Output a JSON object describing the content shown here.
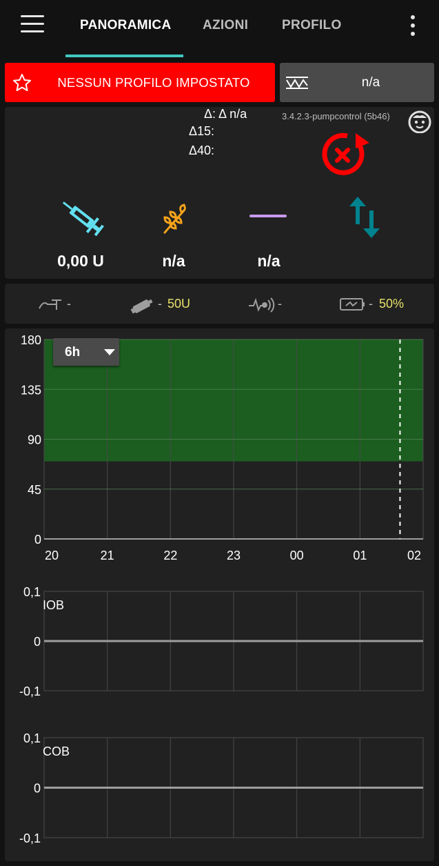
{
  "tabs": [
    {
      "label": "PANORAMICA",
      "active": true
    },
    {
      "label": "AZIONI",
      "active": false
    },
    {
      "label": "PROFILO",
      "active": false
    }
  ],
  "profile": {
    "label": "NESSUN PROFILO IMPOSTATO",
    "color": "#fe0000"
  },
  "target": {
    "value": "n/a"
  },
  "info": {
    "delta": "Δ: Δ n/a",
    "delta15": "Δ15:",
    "delta40": "Δ40:",
    "version": "3.4.2.3-pumpcontrol (5b46)",
    "iob_value": "0,00 U",
    "cob_value": "n/a",
    "basal_value": "n/a"
  },
  "status": {
    "cannula": "-",
    "reservoir_sep": "-",
    "reservoir": "50U",
    "sensor": "-",
    "battery_sep": "-",
    "battery": "50%"
  },
  "range_select": {
    "value": "6h"
  },
  "chart_data": [
    {
      "type": "line",
      "name": "bg",
      "y_ticks": [
        "180",
        "135",
        "90",
        "45",
        "0"
      ],
      "x_ticks": [
        "20",
        "21",
        "22",
        "23",
        "00",
        "01",
        "02"
      ],
      "ylim": [
        0,
        180
      ],
      "target_band": [
        70,
        180
      ],
      "target_color": "#1b5e20",
      "now_marker": "01:40",
      "grid": true,
      "series": []
    },
    {
      "type": "line",
      "title": "IOB",
      "y_ticks": [
        "0,1",
        "0",
        "-0,1"
      ],
      "ylim": [
        -0.1,
        0.1
      ],
      "values": [
        0,
        0,
        0,
        0,
        0,
        0,
        0
      ],
      "grid": true
    },
    {
      "type": "line",
      "title": "COB",
      "y_ticks": [
        "0,1",
        "0",
        "-0,1"
      ],
      "ylim": [
        -0.1,
        0.1
      ],
      "values": [
        0,
        0,
        0,
        0,
        0,
        0,
        0
      ],
      "grid": true
    }
  ],
  "colors": {
    "accent": "#41c8c0",
    "insulin": "#62e0f0",
    "carbs": "#f5a31a",
    "basal": "#c89aee",
    "arrows": "#00838f",
    "loop": "#ff0000",
    "status_value": "#e8e06a"
  }
}
